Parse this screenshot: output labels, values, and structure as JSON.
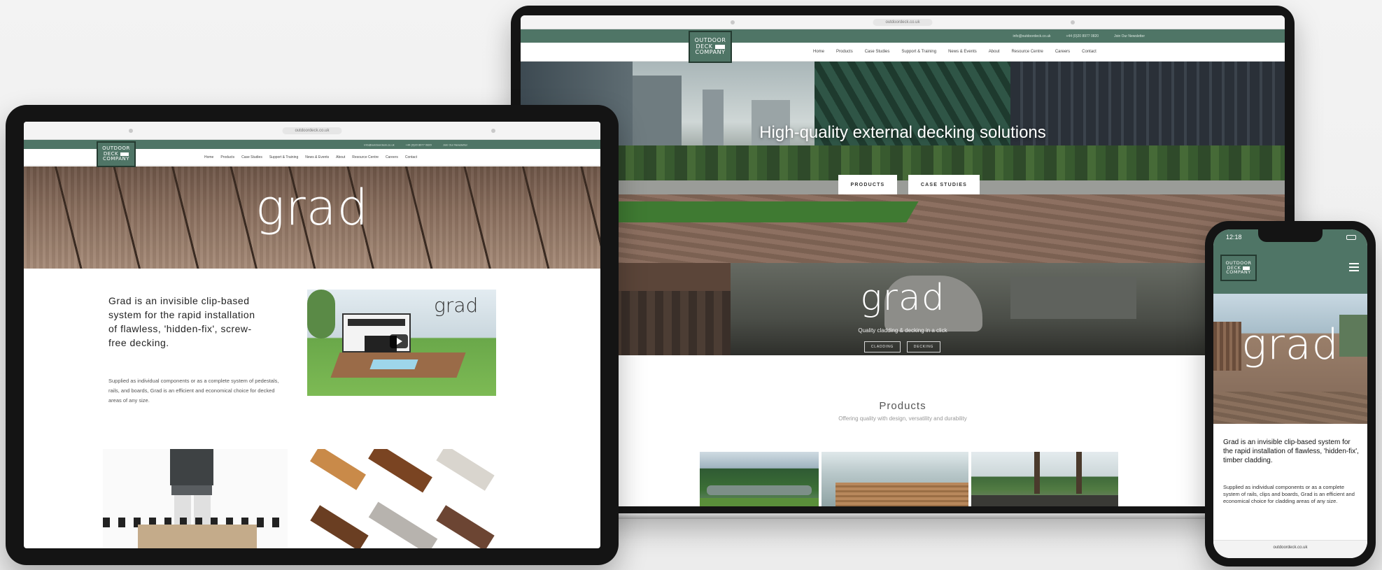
{
  "logo": {
    "line1": "OUTDOOR",
    "line2": "DECK",
    "line3": "COMPANY"
  },
  "browser": {
    "tablet_url": "outdoordeck.co.uk",
    "laptop_url": "outdoordeck.co.uk",
    "phone_url": "outdoordeck.co.uk"
  },
  "topbar": {
    "email": "info@outdoordeck.co.uk",
    "phone": "+44 (0)20 8977 0820",
    "social": "Join Our Newsletter"
  },
  "nav": {
    "items": [
      "Home",
      "Products",
      "Case Studies",
      "Support & Training",
      "News & Events",
      "About",
      "Resource Centre",
      "Careers",
      "Contact"
    ]
  },
  "laptop": {
    "hero_title": "High-quality external decking solutions",
    "btn_products": "PRODUCTS",
    "btn_case_studies": "CASE STUDIES",
    "grad_word": "grad",
    "grad_tagline": "Quality cladding & decking in a click",
    "btn_cladding": "CLADDING",
    "btn_decking": "DECKING",
    "products_title": "Products",
    "products_subtitle": "Offering quality with design, versatility and durability"
  },
  "tablet": {
    "hero_word": "grad",
    "intro_heading": "Grad is an invisible clip-based system for the rapid installation of flawless, 'hidden-fix', screw-free decking.",
    "intro_body": "Supplied as individual components or as a complete system of pedestals, rails, and boards, Grad is an efficient and economical choice for decked areas of any size.",
    "video_logo": "grad"
  },
  "phone": {
    "time": "12:18",
    "hero_word": "grad",
    "intro_heading": "Grad is an invisible clip-based system for the rapid installation of flawless, 'hidden-fix', timber cladding.",
    "intro_body": "Supplied as individual components or as a complete system of rails, clips and boards, Grad is an efficient and economical choice for cladding areas of any size."
  },
  "colors": {
    "brand_green": "#4f7566",
    "brand_dark": "#243a30",
    "device_frame": "#141414"
  }
}
